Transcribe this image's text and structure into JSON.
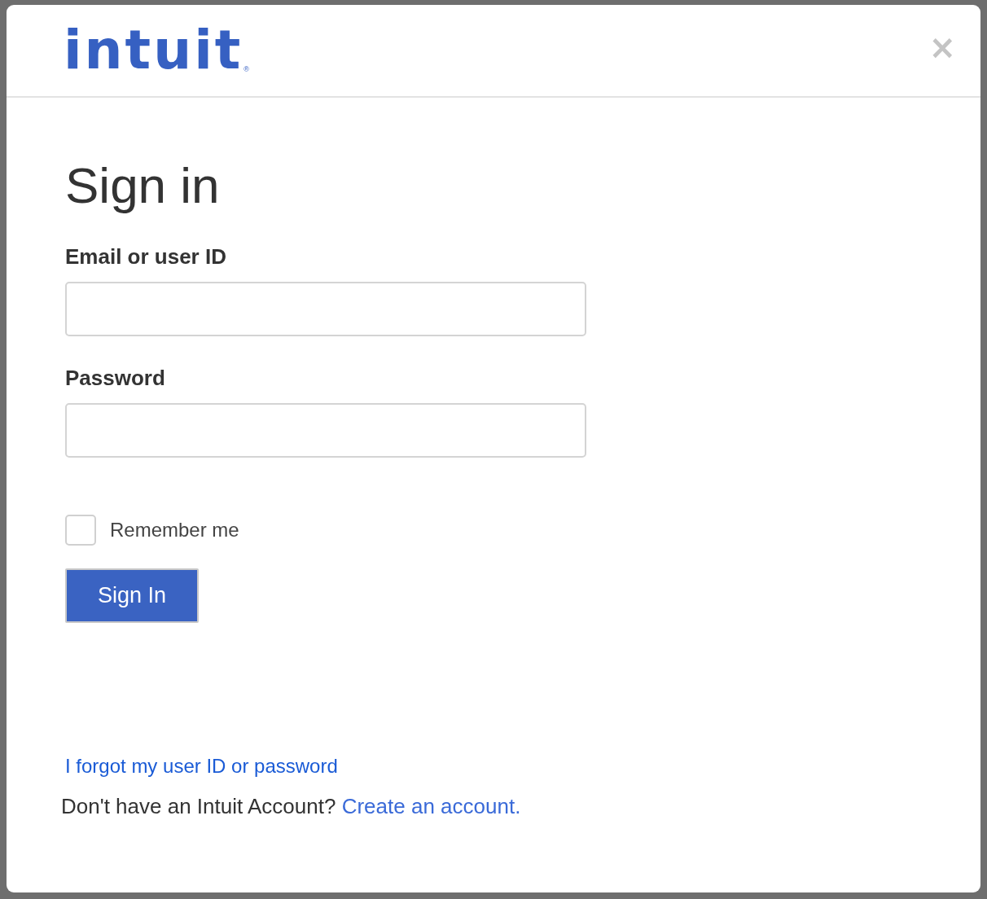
{
  "logo": {
    "text": "intuit",
    "mark": "®"
  },
  "close": "×",
  "title": "Sign in",
  "fields": [
    {
      "label": "Email or user ID"
    },
    {
      "label": "Password"
    }
  ],
  "remember": {
    "label": "Remember me",
    "checked": false
  },
  "submit": "Sign In",
  "forgot_link": "I forgot my user ID or password",
  "footer": {
    "text": "Don't have an Intuit Account?",
    "link": "Create an account."
  }
}
